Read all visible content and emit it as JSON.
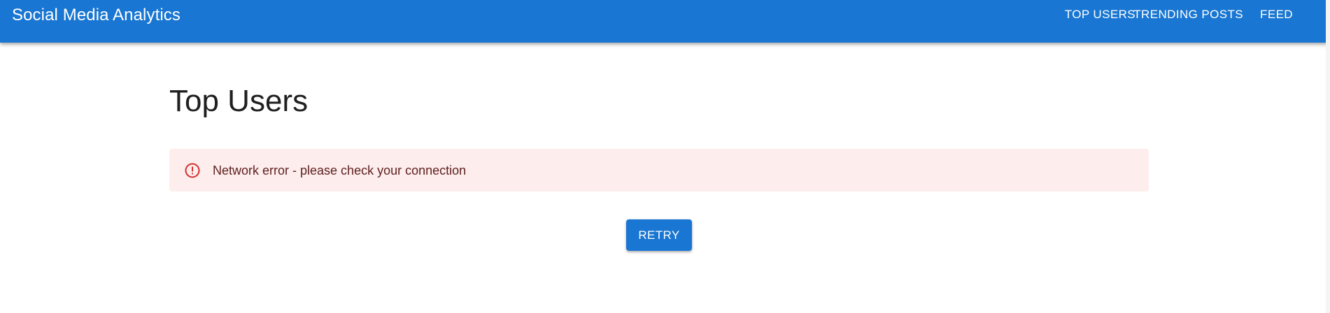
{
  "header": {
    "title": "Social Media Analytics",
    "nav": [
      {
        "label": "TOP USERS"
      },
      {
        "label": "TRENDING POSTS"
      },
      {
        "label": "FEED"
      }
    ]
  },
  "main": {
    "title": "Top Users",
    "alert": {
      "severity": "error",
      "icon": "error-outline-icon",
      "message": "Network error - please check your connection"
    },
    "retry_label": "RETRY"
  },
  "colors": {
    "primary": "#1976d2",
    "error_background": "#fdeded",
    "error_icon": "#d32f2f",
    "error_text": "#5f2120"
  }
}
